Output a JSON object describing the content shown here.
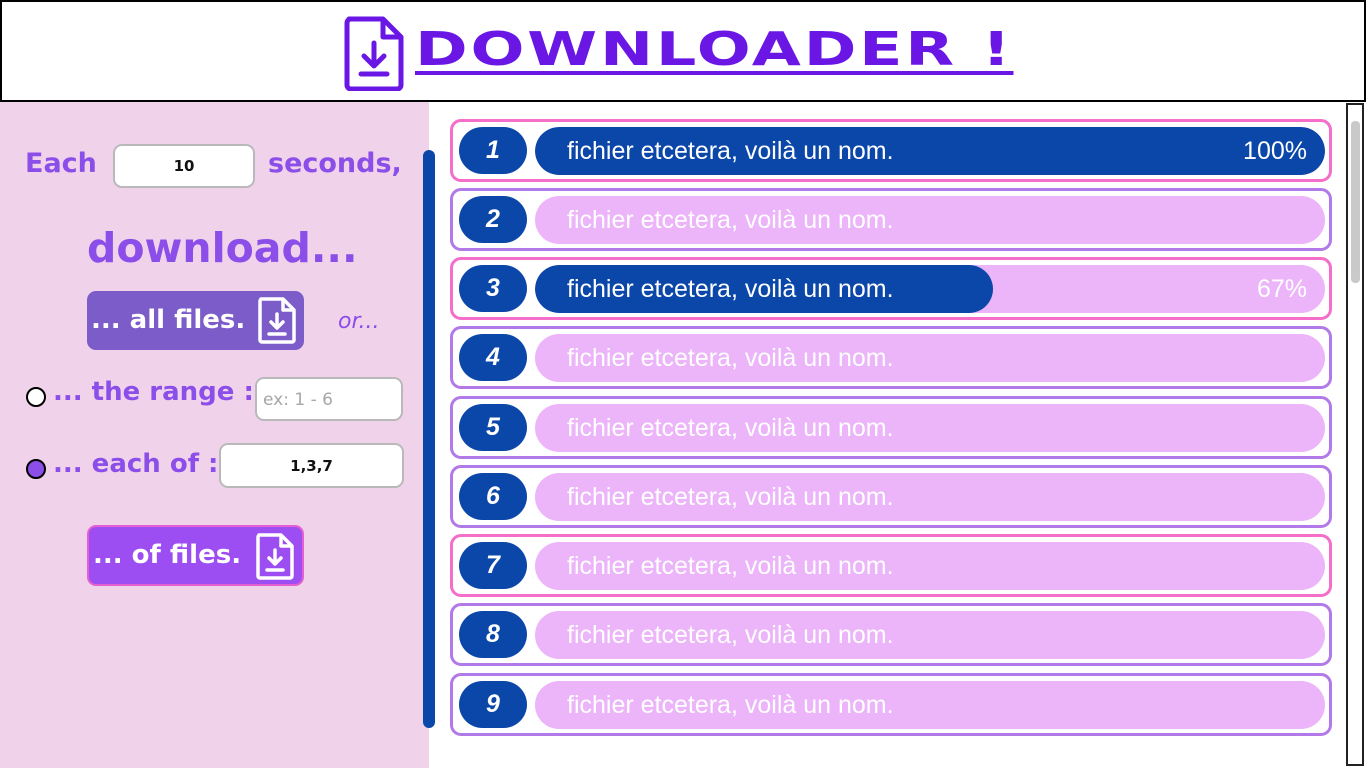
{
  "app": {
    "title": "DOWNLOADER !",
    "logo_icon": "file-download-icon",
    "accent": "#6a17e6"
  },
  "controls": {
    "each_label": "Each",
    "interval_value": "10",
    "seconds_label": "seconds,",
    "download_label": "download...",
    "all_files_button": "... all files.",
    "or_label": "or...",
    "range_label": "... the range :",
    "range_placeholder": "ex: 1 - 6",
    "range_selected": false,
    "each_of_label": "... each of :",
    "each_of_value": "1,3,7",
    "each_of_selected": true,
    "of_files_button": "... of files.",
    "button_icon": "file-download-icon"
  },
  "files": [
    {
      "number": "1",
      "name": "fichier etcetera, voilà un nom.",
      "progress": 1.0,
      "progress_label": "100%",
      "highlighted": true
    },
    {
      "number": "2",
      "name": "fichier etcetera, voilà un nom.",
      "progress": 0,
      "progress_label": "",
      "highlighted": false
    },
    {
      "number": "3",
      "name": "fichier etcetera, voilà un nom.",
      "progress": 0.58,
      "progress_label": "67%",
      "highlighted": true
    },
    {
      "number": "4",
      "name": "fichier etcetera, voilà un nom.",
      "progress": 0,
      "progress_label": "",
      "highlighted": false
    },
    {
      "number": "5",
      "name": "fichier etcetera, voilà un nom.",
      "progress": 0,
      "progress_label": "",
      "highlighted": false
    },
    {
      "number": "6",
      "name": "fichier etcetera, voilà un nom.",
      "progress": 0,
      "progress_label": "",
      "highlighted": false
    },
    {
      "number": "7",
      "name": "fichier etcetera, voilà un nom.",
      "progress": 0,
      "progress_label": "",
      "highlighted": true
    },
    {
      "number": "8",
      "name": "fichier etcetera, voilà un nom.",
      "progress": 0,
      "progress_label": "",
      "highlighted": false
    },
    {
      "number": "9",
      "name": "fichier etcetera, voilà un nom.",
      "progress": 0,
      "progress_label": "",
      "highlighted": false
    }
  ],
  "colors": {
    "number_bg": "#0a47a9",
    "track_bg": "#ecb4f9",
    "progress_fill": "#0a47a9",
    "row_border": "#b27ae8",
    "row_border_highlight": "#f56ec9",
    "left_panel_bg": "#f0d3ea",
    "label_color": "#8b4ee8",
    "all_files_button_bg": "#7b5cc9",
    "of_files_button_bg": "#9d4ef2"
  }
}
